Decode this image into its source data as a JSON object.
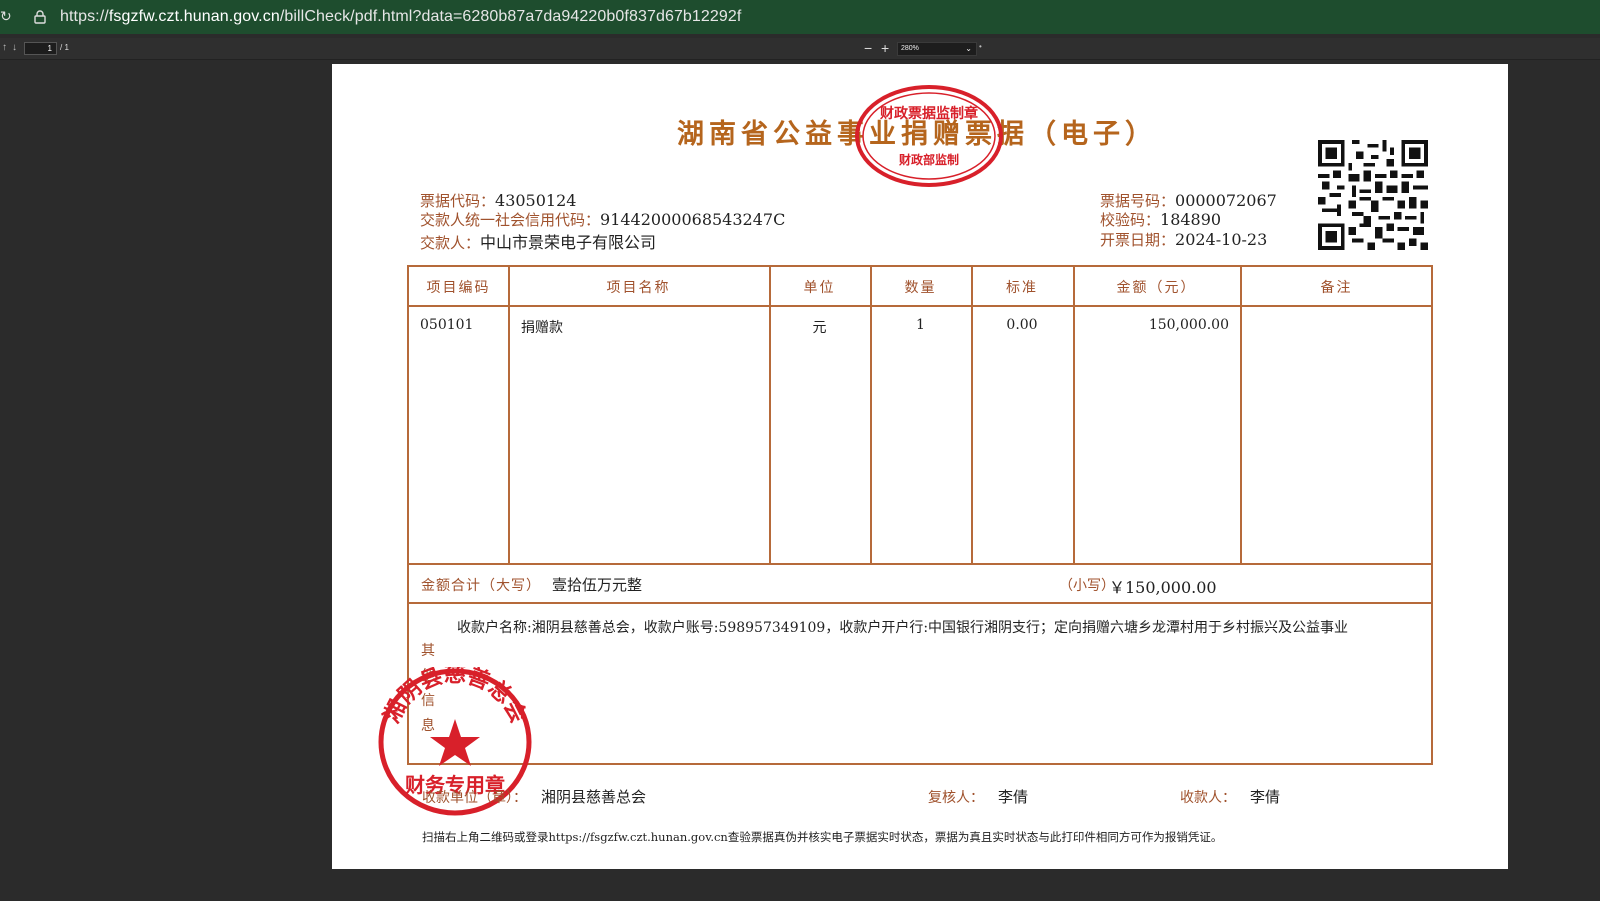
{
  "browser": {
    "url_prefix": "https://",
    "url_host": "fsgzfw.czt.hunan.gov.cn",
    "url_path": "/billCheck/pdf.html?data=6280b87a7da94220b0f837d67b12292f"
  },
  "pdf_toolbar": {
    "page_current": "1",
    "page_total": "/ 1",
    "zoom": "280%"
  },
  "receipt": {
    "title": "湖南省公益事业捐赠票据（电子）",
    "bill_code_label": "票据代码：",
    "bill_code": "43050124",
    "payer_credit_label": "交款人统一社会信用代码：",
    "payer_credit": "91442000068543247C",
    "payer_label": "交款人：",
    "payer": "中山市景荣电子有限公司",
    "bill_no_label": "票据号码：",
    "bill_no": "0000072067",
    "check_code_label": "校验码：",
    "check_code": "184890",
    "issue_date_label": "开票日期：",
    "issue_date": "2024-10-23",
    "columns": [
      "项目编码",
      "项目名称",
      "单位",
      "数量",
      "标准",
      "金额（元）",
      "备注"
    ],
    "rows": [
      {
        "code": "050101",
        "name": "捐赠款",
        "unit": "元",
        "qty": "1",
        "std": "0.00",
        "amount": "150,000.00",
        "remark": ""
      }
    ],
    "total_upper_label": "金额合计（大写）",
    "total_upper": "壹拾伍万元整",
    "total_lower_label": "（小写）",
    "total_lower": "￥150,000.00",
    "other_label": "其他信息",
    "other_text": "收款户名称:湘阴县慈善总会，收款户账号:598957349109，收款户开户行:中国银行湘阴支行；定向捐赠六塘乡龙潭村用于乡村振兴及公益事业",
    "receiver_unit_label": "收款单位（章）：",
    "receiver_unit": "湘阴县慈善总会",
    "reviewer_label": "复核人：",
    "reviewer": "李倩",
    "payee_label": "收款人：",
    "payee": "李倩",
    "note": "扫描右上角二维码或登录https://fsgzfw.czt.hunan.gov.cn查验票据真伪并核实电子票据实时状态，票据为真且实时状态与此打印件相同方可作为报销凭证。"
  },
  "stamps": {
    "top_text": "财政票据监制章",
    "top_bottom": "财政部监制",
    "bottom_text": "湘阴县慈善总会",
    "bottom_bottom": "财务专用章"
  },
  "colors": {
    "accent": "#b66a3a",
    "stamp_red": "#d8202a",
    "url_bar": "#1e4d2e"
  }
}
